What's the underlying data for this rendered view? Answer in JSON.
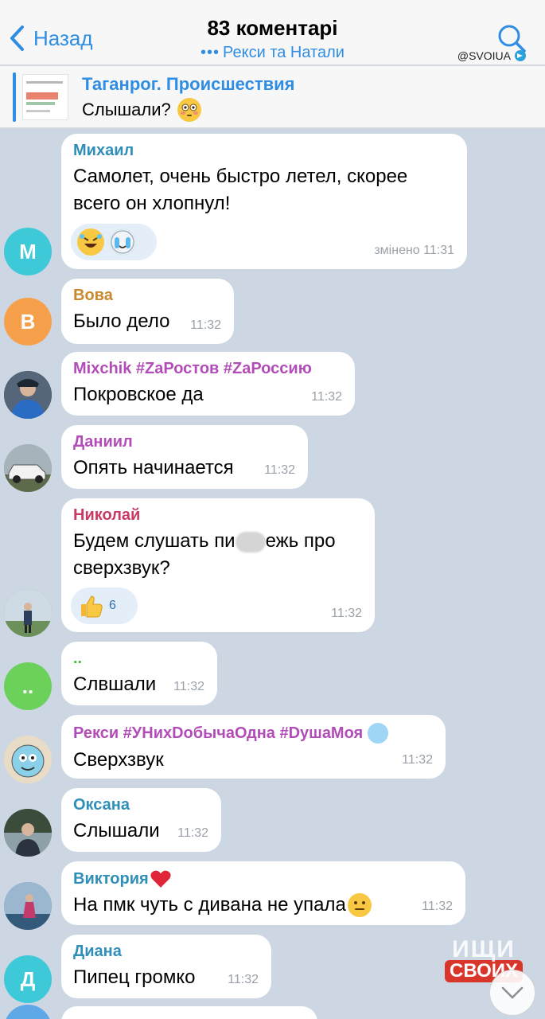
{
  "header": {
    "back_label": "Назад",
    "title": "83 коментарі",
    "subtitle": "Рекси та Натали",
    "subtitle_dots": "•••",
    "watermark": "@SVOIUA"
  },
  "pinned": {
    "title": "Таганрог. Происшествия",
    "text": "Слышали?"
  },
  "messages": [
    {
      "name": "Михаил",
      "name_color": "#2f8fb8",
      "lines": [
        "Самолет, очень быстро летел, скорее",
        "всего он хлопнул!"
      ],
      "time": "змінено 11:31",
      "avatar_letter": "М",
      "avatar_color": "#3ec9d9",
      "reactions": [
        "rolling-laughing-emoji",
        "crying-cat-emoji"
      ]
    },
    {
      "name": "Вова",
      "name_color": "#c98a2e",
      "lines": [
        "Было дело"
      ],
      "time": "11:32",
      "avatar_letter": "В",
      "avatar_color": "#f7a04b"
    },
    {
      "name": "Mixchik #ZaРостов #ZaРоссию",
      "name_color": "#b24cb8",
      "lines": [
        "Покровское да"
      ],
      "time": "11:32"
    },
    {
      "name": "Даниил",
      "name_color": "#b24cb8",
      "lines": [
        "Опять начинается"
      ],
      "time": "11:32"
    },
    {
      "name": "Николай",
      "name_color": "#c93a63",
      "line1_a": "Будем слушать пи",
      "line1_b": "ежь про",
      "line2": "сверхзвук?",
      "time": "11:32",
      "reaction_count": "6"
    },
    {
      "name": "..",
      "name_color": "#4fb84a",
      "lines": [
        "Слвшали"
      ],
      "time": "11:32",
      "avatar_letter": "..",
      "avatar_color": "#6cd15a"
    },
    {
      "name": "Рекси #УНихDобычаОдна #DушаМоя",
      "name_color": "#b24cb8",
      "lines": [
        "Сверхзвук"
      ],
      "time": "11:32"
    },
    {
      "name": "Оксана",
      "name_color": "#2f8fb8",
      "lines": [
        "Слышали"
      ],
      "time": "11:32"
    },
    {
      "name": "Виктория",
      "name_color": "#2f8fb8",
      "lines": [
        "На пмк чуть с дивана не упала"
      ],
      "time": "11:32"
    },
    {
      "name": "Диана",
      "name_color": "#2f8fb8",
      "lines": [
        "Пипец громко"
      ],
      "time": "11:32",
      "avatar_letter": "Д",
      "avatar_color": "#3ec9d9"
    }
  ],
  "watermark_logo": {
    "line1": "ИЩИ",
    "line2": "СВОИХ"
  }
}
